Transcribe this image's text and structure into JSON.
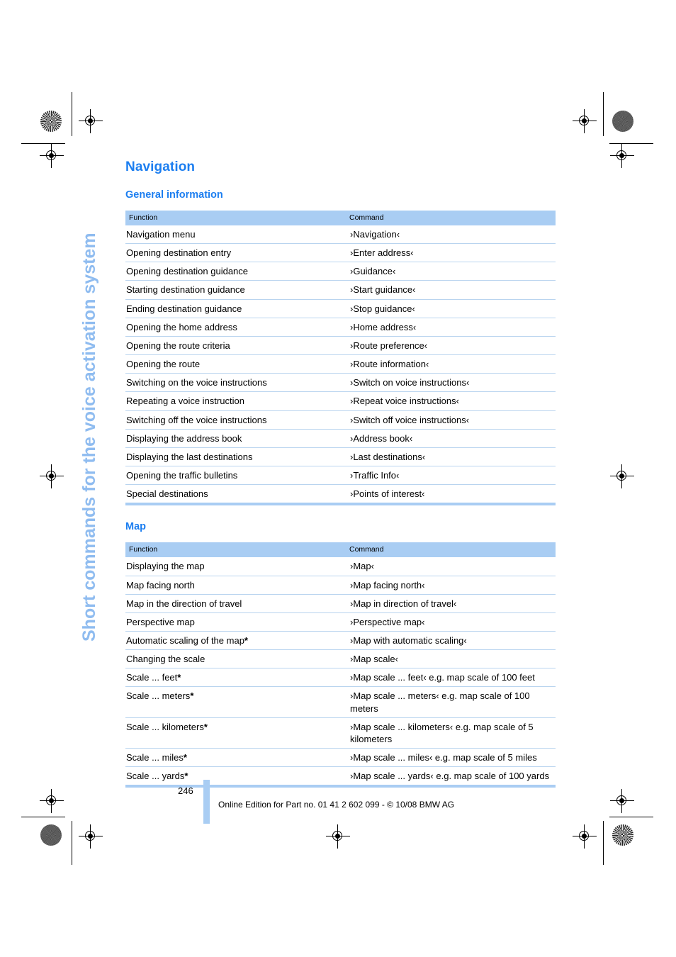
{
  "side_tab": {
    "text": "Short commands for the voice activation system",
    "color": "#8fbcf0"
  },
  "section": {
    "title": "Navigation",
    "title_color": "#1c7ef0"
  },
  "tables": [
    {
      "heading": "General information",
      "columns": [
        "Function",
        "Command"
      ],
      "rows": [
        {
          "function": "Navigation menu",
          "command": "›Navigation‹"
        },
        {
          "function": "Opening destination entry",
          "command": "›Enter address‹"
        },
        {
          "function": "Opening destination guidance",
          "command": "›Guidance‹"
        },
        {
          "function": "Starting destination guidance",
          "command": "›Start guidance‹"
        },
        {
          "function": "Ending destination guidance",
          "command": "›Stop guidance‹"
        },
        {
          "function": "Opening the home address",
          "command": "›Home address‹"
        },
        {
          "function": "Opening the route criteria",
          "command": "›Route preference‹"
        },
        {
          "function": "Opening the route",
          "command": "›Route information‹"
        },
        {
          "function": "Switching on the voice instructions",
          "command": "›Switch on voice instructions‹"
        },
        {
          "function": "Repeating a voice instruction",
          "command": "›Repeat voice instructions‹"
        },
        {
          "function": "Switching off the voice instructions",
          "command": "›Switch off voice instructions‹"
        },
        {
          "function": "Displaying the address book",
          "command": "›Address book‹"
        },
        {
          "function": "Displaying the last destinations",
          "command": "›Last destinations‹"
        },
        {
          "function": "Opening the traffic bulletins",
          "command": "›Traffic Info‹"
        },
        {
          "function": "Special destinations",
          "command": "›Points of interest‹"
        }
      ]
    },
    {
      "heading": "Map",
      "columns": [
        "Function",
        "Command"
      ],
      "rows": [
        {
          "function": "Displaying the map",
          "command": "›Map‹"
        },
        {
          "function": "Map facing north",
          "command": "›Map facing north‹"
        },
        {
          "function": "Map in the direction of travel",
          "command": "›Map in direction of travel‹"
        },
        {
          "function": "Perspective map",
          "command": "›Perspective map‹"
        },
        {
          "function": "Automatic scaling of the map",
          "function_star": "*",
          "command": "›Map with automatic scaling‹"
        },
        {
          "function": "Changing the scale",
          "command": "›Map scale‹"
        },
        {
          "function": "Scale ... feet",
          "function_star": "*",
          "command": "›Map scale  ...  feet‹ e.g. map scale of 100 feet"
        },
        {
          "function": "Scale ... meters",
          "function_star": "*",
          "command": "›Map scale  ...  meters‹ e.g. map scale of 100 meters"
        },
        {
          "function": "Scale ... kilometers",
          "function_star": "*",
          "command": "›Map scale  ...  kilometers‹ e.g. map scale of 5 kilometers"
        },
        {
          "function": "Scale ... miles",
          "function_star": "*",
          "command": "›Map scale  ...  miles‹ e.g. map scale of 5 miles"
        },
        {
          "function": "Scale ... yards",
          "function_star": "*",
          "command": "›Map scale  ...  yards‹ e.g. map scale of 100 yards"
        }
      ]
    }
  ],
  "footer": {
    "page_number": "246",
    "text": "Online Edition for Part no. 01 41 2 602 099 - © 10/08 BMW AG"
  }
}
